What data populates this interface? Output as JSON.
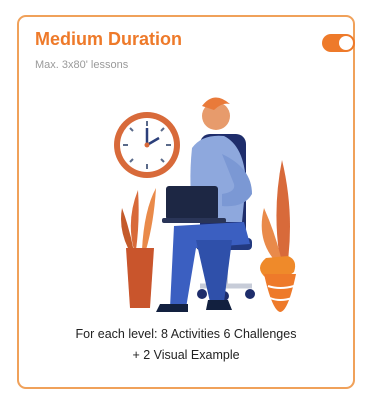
{
  "card": {
    "title": "Medium Duration",
    "subtitle": "Max. 3x80' lessons",
    "toggle": {
      "state": "on",
      "color": "#ee7a2a"
    },
    "description_line1": "For each level: 8 Activities 6 Challenges",
    "description_line2": "+ 2 Visual Example",
    "accent_color": "#ee7a2a",
    "border_color": "#f0a15a"
  }
}
